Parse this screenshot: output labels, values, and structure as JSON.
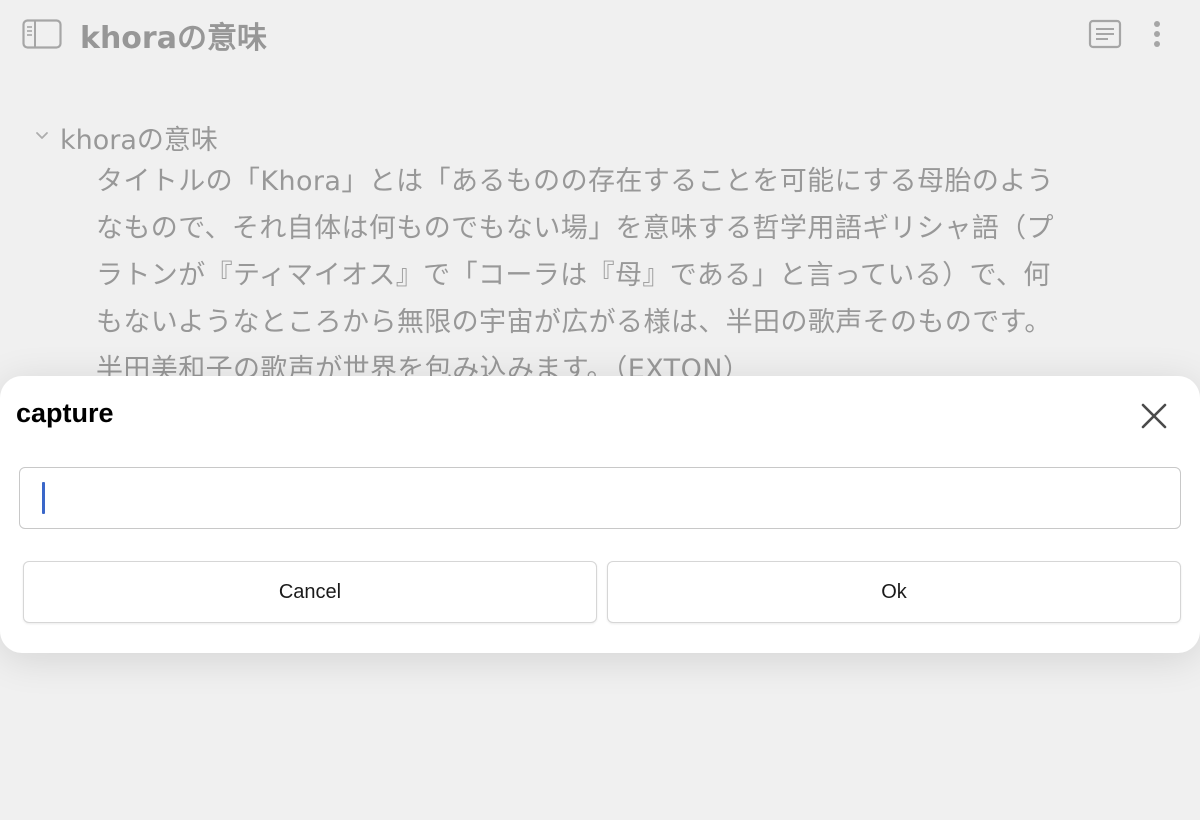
{
  "page": {
    "title": "khoraの意味"
  },
  "outline": {
    "bullet_title": "khoraの意味",
    "note_lines": [
      "タイトルの「Khora」とは「あるものの存在することを可能にする母胎のよう",
      "なもので、それ自体は何ものでもない場」を意味する哲学用語ギリシャ語（プ",
      "ラトンが『ティマイオス』で「コーラは『母』である」と言っている）で、何",
      "もないようなところから無限の宇宙が広がる様は、半田の歌声そのものです。",
      "半田美和子の歌声が世界を包み込みます。（EXTON）"
    ]
  },
  "dialog": {
    "title": "capture",
    "input_value": "",
    "cancel_label": "Cancel",
    "ok_label": "Ok"
  },
  "icons": {
    "sidebar": "sidebar-toggle-icon",
    "reader": "reader-view-icon",
    "more": "more-vertical-icon",
    "chevron": "chevron-down-icon",
    "close": "close-icon"
  },
  "colors": {
    "caret": "#3a67c9",
    "overlay": "#e4e4e4",
    "text": "#3d3d3d"
  }
}
